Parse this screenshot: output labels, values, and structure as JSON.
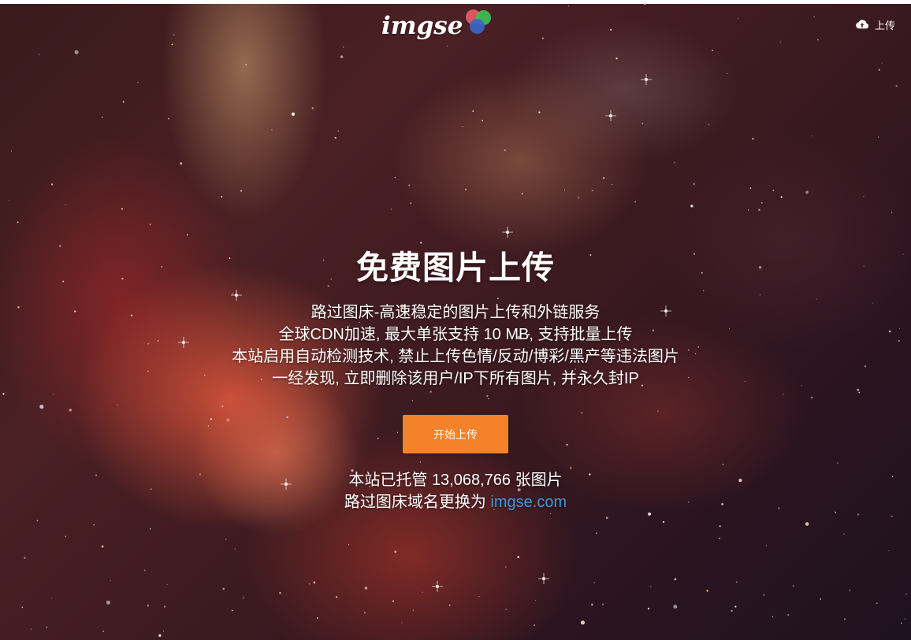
{
  "header": {
    "logo_text": "imgse",
    "logo_colors": [
      "#e85b66",
      "#3fbf55",
      "#3a66c8"
    ],
    "upload_label": "上传",
    "upload_icon": "cloud-upload-icon"
  },
  "hero": {
    "title": "免费图片上传",
    "description_lines": [
      "路过图床-高速稳定的图片上传和外链服务",
      "全球CDN加速, 最大单张支持 10 MB, 支持批量上传",
      "本站启用自动检测技术, 禁止上传色情/反动/博彩/黑产等违法图片",
      "一经发现, 立即删除该用户/IP下所有图片, 并永久封IP"
    ],
    "start_button_label": "开始上传",
    "button_color": "#f58229"
  },
  "stats": {
    "hosted_prefix": "本站已托管",
    "hosted_count": "13,068,766",
    "hosted_suffix": "张图片",
    "domain_prefix": "路过图床域名更换为",
    "domain_link": "imgse.com",
    "link_color": "#3d99dd"
  }
}
